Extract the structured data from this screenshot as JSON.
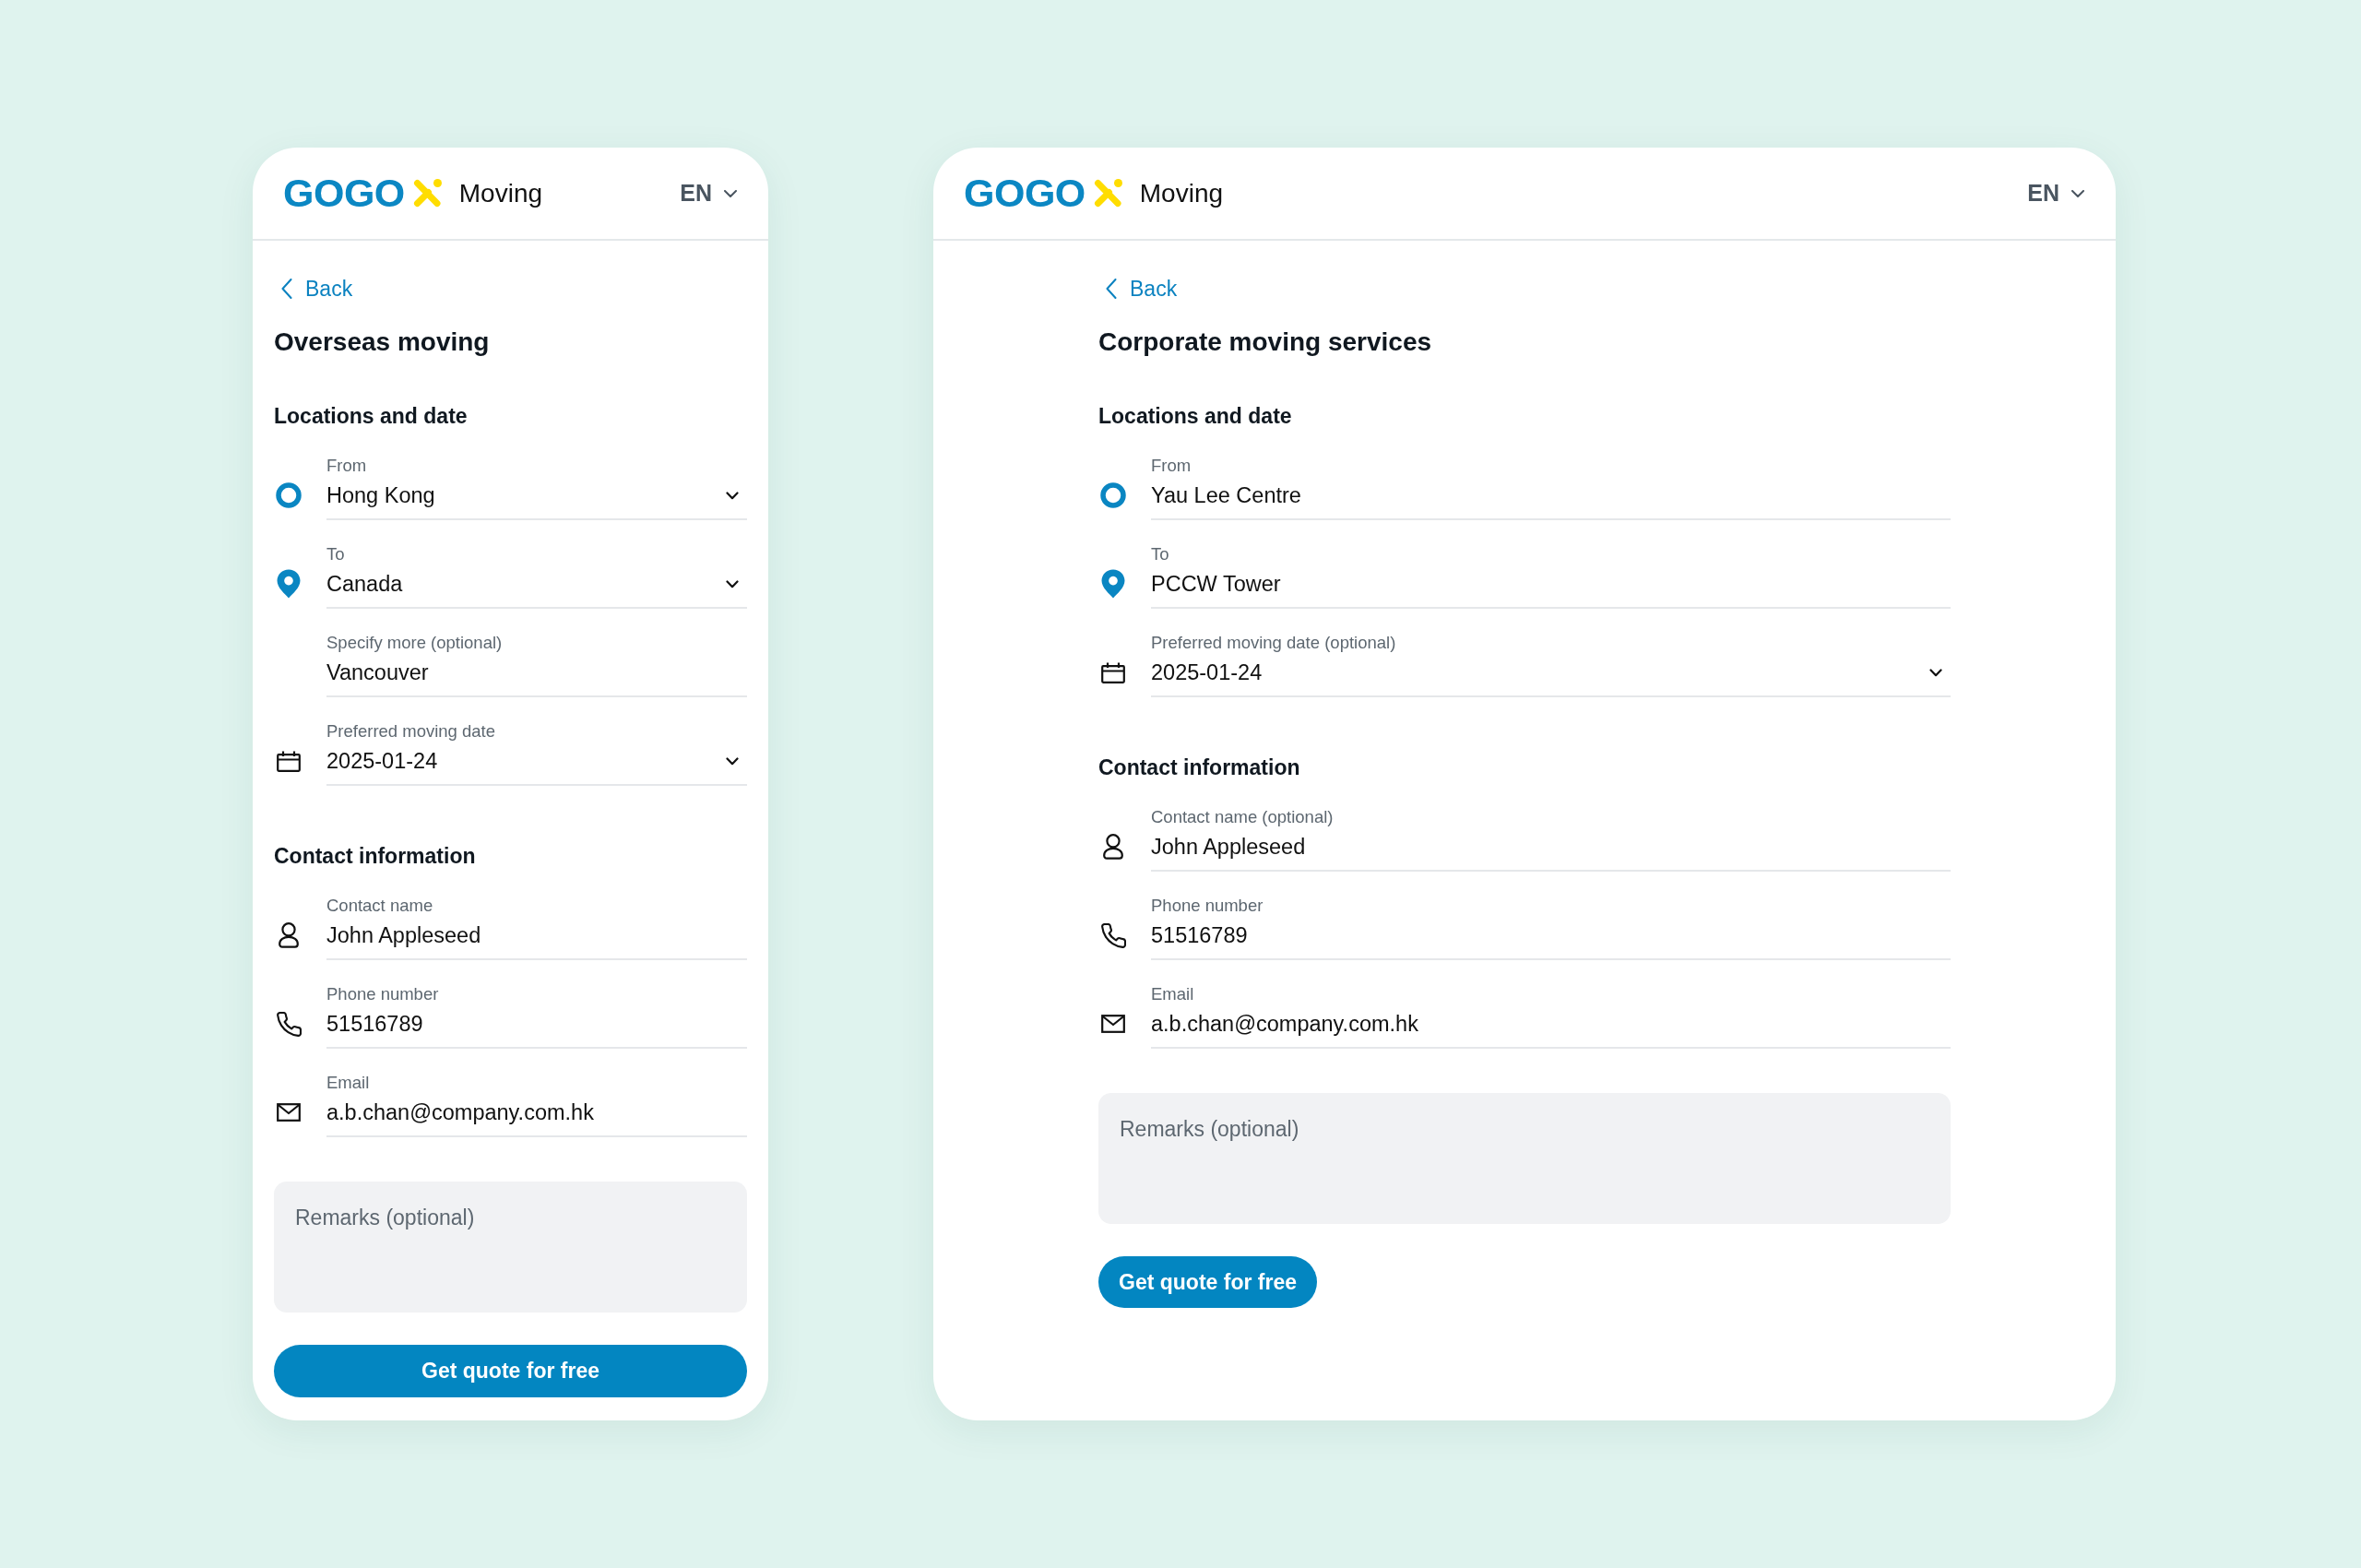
{
  "screens": [
    {
      "kind": "mobile",
      "header": {
        "logo": "GOGO",
        "product": "Moving",
        "language": "EN"
      },
      "back_link": "Back",
      "title": "Overseas moving",
      "sections": [
        {
          "heading": "Locations and date",
          "fields": [
            {
              "kind": "origin",
              "label": "From",
              "value": "Hong Kong",
              "dropdown": true
            },
            {
              "kind": "destination",
              "label": "To",
              "value": "Canada",
              "dropdown": true
            },
            {
              "kind": "detail",
              "label": "Specify more (optional)",
              "value": "Vancouver",
              "dropdown": false
            },
            {
              "kind": "date",
              "label": "Preferred moving date",
              "value": "2025-01-24",
              "dropdown": true
            }
          ]
        },
        {
          "heading": "Contact information",
          "fields": [
            {
              "kind": "name",
              "label": "Contact name",
              "value": "John Appleseed",
              "dropdown": false
            },
            {
              "kind": "phone",
              "label": "Phone number",
              "value": "51516789",
              "dropdown": false
            },
            {
              "kind": "email",
              "label": "Email",
              "value": "a.b.chan@company.com.hk",
              "dropdown": false
            }
          ]
        }
      ],
      "remarks": {
        "placeholder": "Remarks (optional)"
      },
      "submit_button": "Get quote for free"
    },
    {
      "kind": "desktop",
      "header": {
        "logo": "GOGO",
        "product": "Moving",
        "language": "EN"
      },
      "back_link": "Back",
      "title": "Corporate moving services",
      "sections": [
        {
          "heading": "Locations and date",
          "fields": [
            {
              "kind": "origin",
              "label": "From",
              "value": "Yau Lee Centre",
              "dropdown": false
            },
            {
              "kind": "destination",
              "label": "To",
              "value": "PCCW Tower",
              "dropdown": false
            },
            {
              "kind": "date",
              "label": "Preferred moving date (optional)",
              "value": "2025-01-24",
              "dropdown": true
            }
          ]
        },
        {
          "heading": "Contact information",
          "fields": [
            {
              "kind": "name",
              "label": "Contact name (optional)",
              "value": "John Appleseed",
              "dropdown": false
            },
            {
              "kind": "phone",
              "label": "Phone number",
              "value": "51516789",
              "dropdown": false
            },
            {
              "kind": "email",
              "label": "Email",
              "value": "a.b.chan@company.com.hk",
              "dropdown": false
            }
          ]
        }
      ],
      "remarks": {
        "placeholder": "Remarks (optional)"
      },
      "submit_button": "Get quote for free"
    }
  ]
}
